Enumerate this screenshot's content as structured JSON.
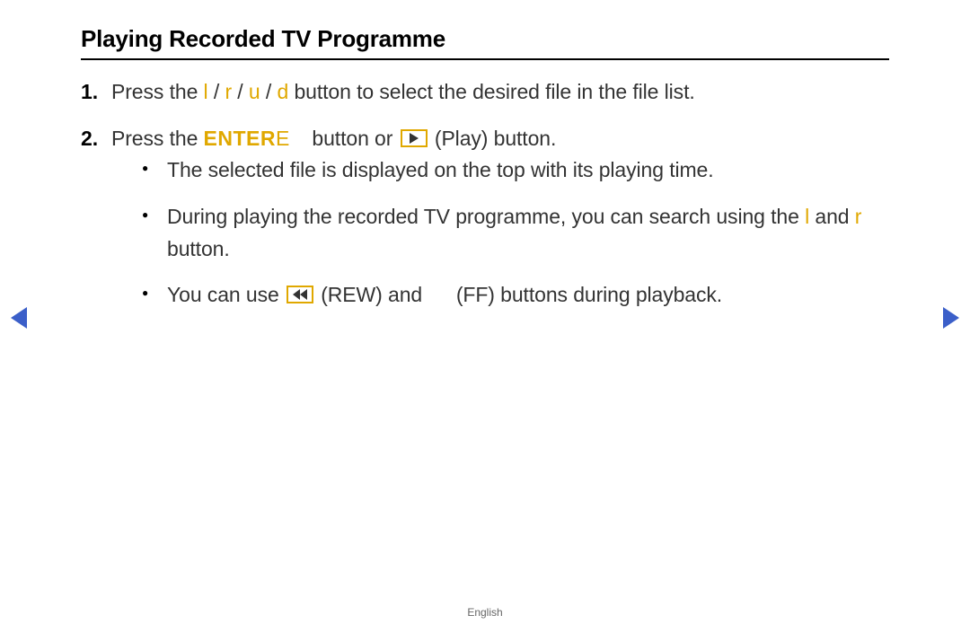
{
  "title": "Playing Recorded TV Programme",
  "step1": {
    "num": "1.",
    "t1": "Press the ",
    "l": "l",
    "sep1": " / ",
    "r": "r",
    "sep2": " / ",
    "u": "u",
    "sep3": " / ",
    "d": "d",
    "t2": " button to select the desired file in the file list."
  },
  "step2": {
    "num": "2.",
    "t1": "Press the ",
    "enter_label": "ENTER",
    "enter_e": "E",
    "t2": " button or ",
    "t3": " (Play) button."
  },
  "bullets": {
    "b1": "The selected file is displayed on the top with its playing time.",
    "b2": {
      "t1": "During playing the recorded TV programme, you can search using the ",
      "l": "l",
      "t2": " and ",
      "r": "r",
      "t3": " button."
    },
    "b3": {
      "t1": "You can use ",
      "t2": " (REW) and ",
      "t3": " (FF) buttons during playback."
    }
  },
  "footer": "English"
}
